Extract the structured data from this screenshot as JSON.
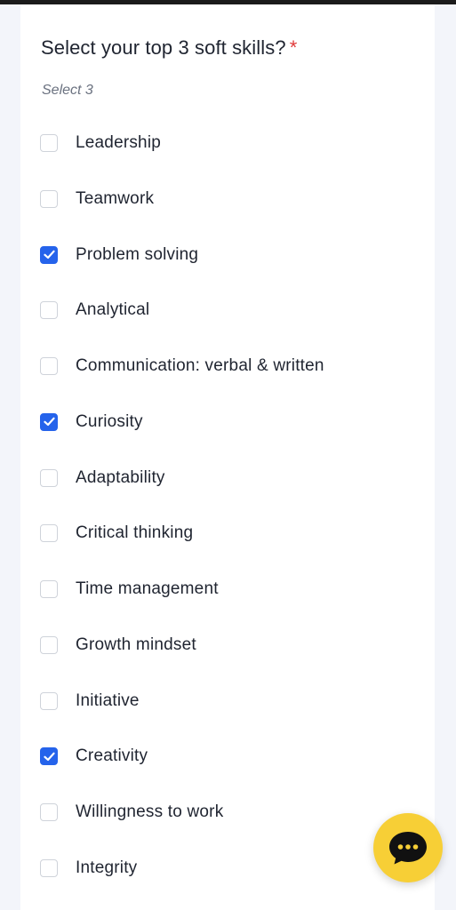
{
  "question": {
    "title": "Select your top 3 soft skills?",
    "required_marker": "*",
    "hint": "Select 3"
  },
  "options": [
    {
      "label": "Leadership",
      "checked": false
    },
    {
      "label": "Teamwork",
      "checked": false
    },
    {
      "label": "Problem solving",
      "checked": true
    },
    {
      "label": "Analytical",
      "checked": false
    },
    {
      "label": "Communication: verbal & written",
      "checked": false
    },
    {
      "label": "Curiosity",
      "checked": true
    },
    {
      "label": "Adaptability",
      "checked": false
    },
    {
      "label": "Critical thinking",
      "checked": false
    },
    {
      "label": "Time management",
      "checked": false
    },
    {
      "label": "Growth mindset",
      "checked": false
    },
    {
      "label": "Initiative",
      "checked": false
    },
    {
      "label": "Creativity",
      "checked": true
    },
    {
      "label": "Willingness to work",
      "checked": false
    },
    {
      "label": "Integrity",
      "checked": false
    }
  ],
  "colors": {
    "accent": "#2563eb",
    "required": "#e03a3a",
    "chat_button": "#f7cf36"
  },
  "chat_button": {
    "icon": "chat-bubble-icon"
  }
}
